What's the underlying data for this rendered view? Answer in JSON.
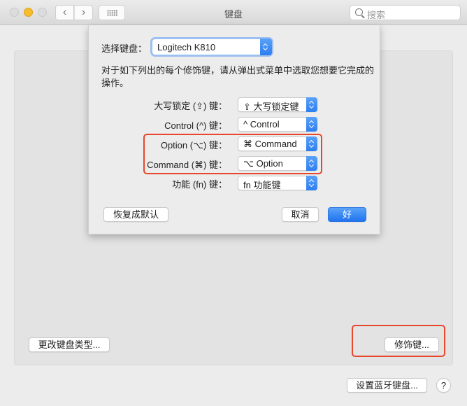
{
  "window": {
    "title": "键盘",
    "search_placeholder": "搜索",
    "nav": {
      "back": "‹",
      "forward": "›"
    }
  },
  "main": {
    "change_keyboard_type_button": "更改键盘类型...",
    "modifier_keys_button": "修饰键...",
    "setup_bluetooth_button": "设置蓝牙键盘...",
    "help_button": "?"
  },
  "sheet": {
    "select_keyboard_label": "选择键盘：",
    "selected_keyboard": "Logitech K810",
    "description": "对于如下列出的每个修饰键，请从弹出式菜单中选取您想要它完成的操作。",
    "rows": [
      {
        "label": "大写锁定 (⇪) 键：",
        "value": "⇪ 大写锁定键"
      },
      {
        "label": "Control (^) 键：",
        "value": "^ Control"
      },
      {
        "label": "Option (⌥) 键：",
        "value": "⌘ Command"
      },
      {
        "label": "Command (⌘) 键：",
        "value": "⌥ Option"
      },
      {
        "label": "功能 (fn) 键：",
        "value": "fn 功能键"
      }
    ],
    "restore_defaults_button": "恢复成默认",
    "cancel_button": "取消",
    "ok_button": "好"
  },
  "colors": {
    "accent": "#2e7ef0",
    "highlight_box": "#e7472c"
  }
}
